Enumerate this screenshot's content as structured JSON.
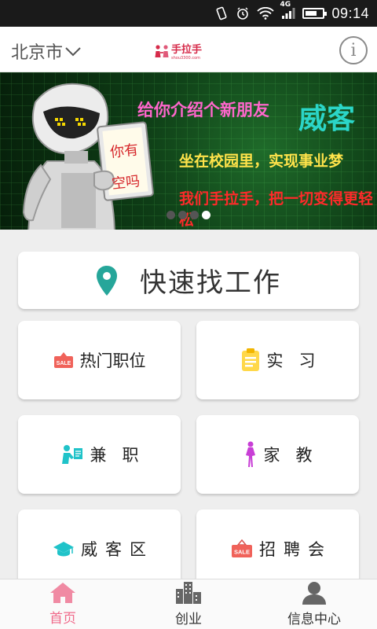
{
  "status_bar": {
    "network": "4G",
    "time": "09:14",
    "battery_level": 0.7
  },
  "header": {
    "city": "北京市",
    "logo_text": "手拉手",
    "logo_sub": "shou3300.com"
  },
  "banner": {
    "line1": "给你介绍个新朋友",
    "brand": "威客",
    "sign_text_1": "你有",
    "sign_text_2": "空吗",
    "line2": "坐在校园里，实现事业梦",
    "line3": "我们手拉手，把一切变得更轻松",
    "page_count": 4,
    "active_page": 4
  },
  "quick_find": {
    "label": "快速找工作",
    "icon": "location-pin-icon",
    "icon_color": "#26a69a"
  },
  "tiles": [
    {
      "label": "热门职位",
      "icon": "sale-tag-icon"
    },
    {
      "label": "实习",
      "icon": "clipboard-icon"
    },
    {
      "label": "兼职",
      "icon": "worker-icon"
    },
    {
      "label": "家教",
      "icon": "woman-icon"
    },
    {
      "label": "威客区",
      "icon": "graduation-cap-icon"
    },
    {
      "label": "招聘会",
      "icon": "sale-sign-icon"
    }
  ],
  "tabbar": {
    "items": [
      {
        "label": "首页",
        "icon": "home-icon",
        "active": true
      },
      {
        "label": "创业",
        "icon": "buildings-icon",
        "active": false
      },
      {
        "label": "信息中心",
        "icon": "user-icon",
        "active": false
      }
    ]
  },
  "colors": {
    "accent_pink": "#f06b8b",
    "teal": "#26a69a",
    "sale_red": "#f0625a",
    "clipboard_yellow": "#ffd84a",
    "cyan_person": "#20c3c9",
    "woman_purple": "#c83fd6"
  }
}
